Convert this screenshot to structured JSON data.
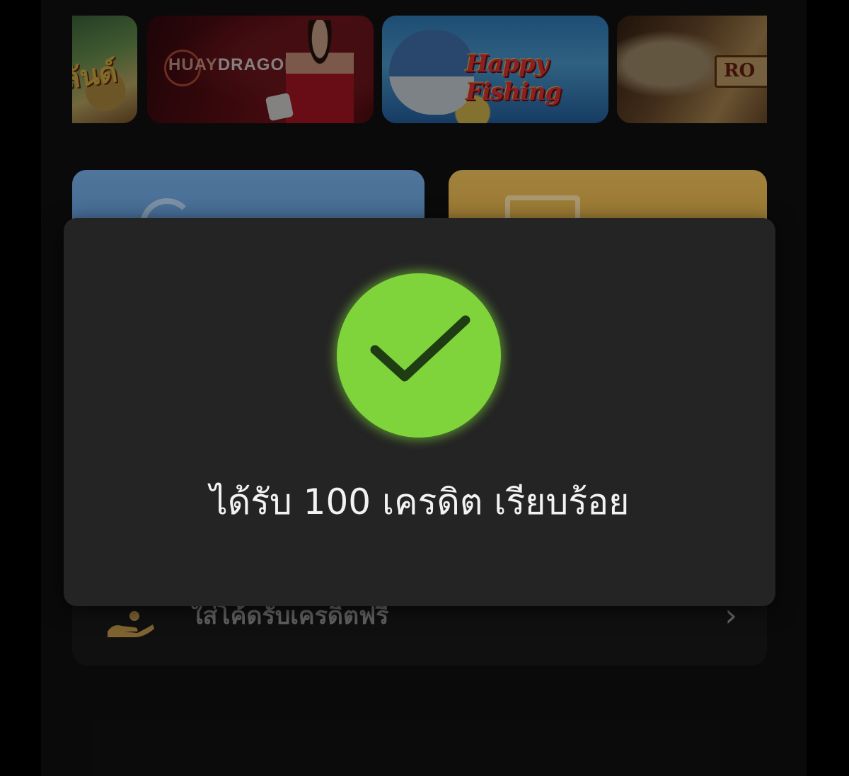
{
  "games": [
    {
      "name": "",
      "art_text": "ลันด์"
    },
    {
      "name": "HUAYDRAGON",
      "brand_a": "HUAY",
      "brand_b": "DRAGON"
    },
    {
      "name": "Happy Fishing",
      "title": "Happy Fishing"
    },
    {
      "name": "",
      "plate_text": "RO"
    }
  ],
  "redeem_row": {
    "label": "ใส่โค้ดรับเครดิตฟรี",
    "chevron": "›"
  },
  "modal": {
    "message": "ได้รับ 100 เครดิต เรียบร้อย",
    "status_icon": "check-circle-icon",
    "accent_color": "#7ed43a"
  },
  "colors": {
    "background": "#0f0f0f",
    "modal_bg": "#242424",
    "blue_button": "#5a91cb",
    "gold_button": "#d4a543"
  }
}
